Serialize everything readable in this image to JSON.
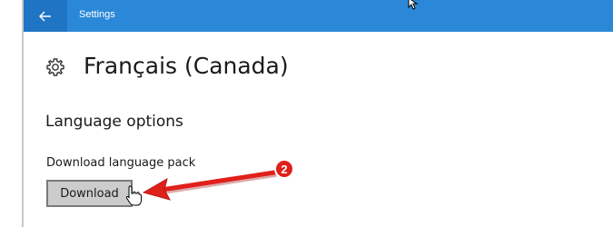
{
  "window": {
    "app_title": "Settings",
    "back_icon": "back-arrow-icon",
    "accent": "#2b88d8"
  },
  "header": {
    "title": "Français (Canada)",
    "icon": "gear-icon"
  },
  "section": {
    "title": "Language options",
    "download_label": "Download language pack",
    "download_button": "Download"
  },
  "annotation": {
    "step_number": "2",
    "color": "#e0201b"
  }
}
